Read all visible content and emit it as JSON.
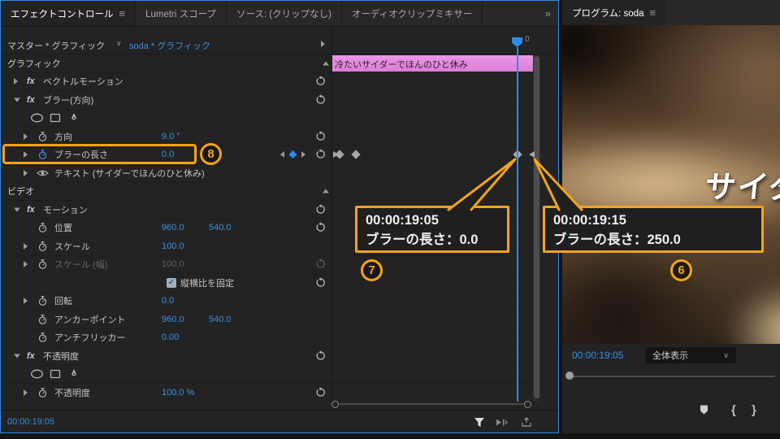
{
  "left_panel": {
    "menu_icon": "≡",
    "overflow_chevron": "»",
    "tabs": [
      {
        "label": "エフェクトコントロール",
        "active": true
      },
      {
        "label": "Lumetri スコープ",
        "active": false
      },
      {
        "label": "ソース: (クリップなし)",
        "active": false
      },
      {
        "label": "オーディオクリップミキサー",
        "active": false
      }
    ],
    "clip_selector": {
      "master": "マスター * グラフィック",
      "clip": "soda * グラフィック",
      "caret": "∨"
    },
    "ruler_end_label": "0",
    "status_timecode": "00:00:19:05",
    "rows": [
      {
        "t": "header",
        "name": "graphics-section",
        "label": "グラフィック"
      },
      {
        "t": "fx",
        "name": "vector-motion",
        "twirl": "r",
        "label": "ベクトルモーション",
        "reset": true
      },
      {
        "t": "fx",
        "name": "blur-direction",
        "twirl": "d",
        "label": "ブラー(方向)",
        "reset": true
      },
      {
        "t": "shapes",
        "name": "blur-masks"
      },
      {
        "t": "param",
        "name": "direction",
        "twirl": "r",
        "sw": 1,
        "label": "方向",
        "value": "9.0 °",
        "reset": true
      },
      {
        "t": "param",
        "name": "blur-length",
        "twirl": "r",
        "sw": 2,
        "label": "ブラーの長さ",
        "value": "0.0",
        "nav": true,
        "reset": true
      },
      {
        "t": "param",
        "name": "text-layer",
        "twirl": "r",
        "eye": true,
        "label": "テキスト (サイダーでほんのひと休み)"
      },
      {
        "t": "header",
        "name": "video-section",
        "label": "ビデオ"
      },
      {
        "t": "fx",
        "name": "motion",
        "twirl": "d",
        "label": "モーション",
        "reset": true
      },
      {
        "t": "param",
        "name": "position",
        "sw": 1,
        "label": "位置",
        "value": "960.0",
        "value2": "540.0",
        "reset": true
      },
      {
        "t": "param",
        "name": "scale",
        "twirl": "r",
        "sw": 1,
        "label": "スケール",
        "value": "100.0"
      },
      {
        "t": "param",
        "name": "scale-width",
        "twirl": "r",
        "sw": 1,
        "label": "スケール (幅)",
        "value": "100.0",
        "dim": true,
        "reset": "dim"
      },
      {
        "t": "check",
        "name": "uniform-scale",
        "label": "縦横比を固定",
        "reset": true
      },
      {
        "t": "param",
        "name": "rotation",
        "twirl": "r",
        "sw": 1,
        "label": "回転",
        "value": "0.0"
      },
      {
        "t": "param",
        "name": "anchor-point",
        "sw": 1,
        "label": "アンカーポイント",
        "value": "960.0",
        "value2": "540.0"
      },
      {
        "t": "param",
        "name": "anti-flicker",
        "sw": 1,
        "label": "アンチフリッカー",
        "value": "0.00"
      },
      {
        "t": "fx",
        "name": "opacity-effect",
        "twirl": "d",
        "label": "不透明度",
        "reset": true
      },
      {
        "t": "shapes",
        "name": "opacity-masks"
      },
      {
        "t": "param",
        "name": "opacity",
        "twirl": "r",
        "sw": 1,
        "label": "不透明度",
        "value": "100.0 %",
        "reset": true
      }
    ]
  },
  "timeline": {
    "clip_label": "冷たいサイダーでほんのひと休み"
  },
  "annotations": {
    "row_badge": "8",
    "callouts": [
      {
        "badge": "7",
        "timecode": "00:00:19:05",
        "label": "ブラーの長さ：0.0"
      },
      {
        "badge": "6",
        "timecode": "00:00:19:15",
        "label": "ブラーの長さ：250.0"
      }
    ]
  },
  "program": {
    "tab_label": "プログラム: soda",
    "menu_icon": "≡",
    "overlay_text": "サイダーでほんのひと休み",
    "timecode": "00:00:19:05",
    "fit_mode": "全体表示",
    "caret": "∨",
    "brace_left": "{",
    "brace_right": "}"
  },
  "colors": {
    "accent_blue": "#2d8ceb",
    "value_blue": "#3d8ede",
    "annotation_orange": "#f5a31d",
    "clip_pink": "#df85dc"
  }
}
